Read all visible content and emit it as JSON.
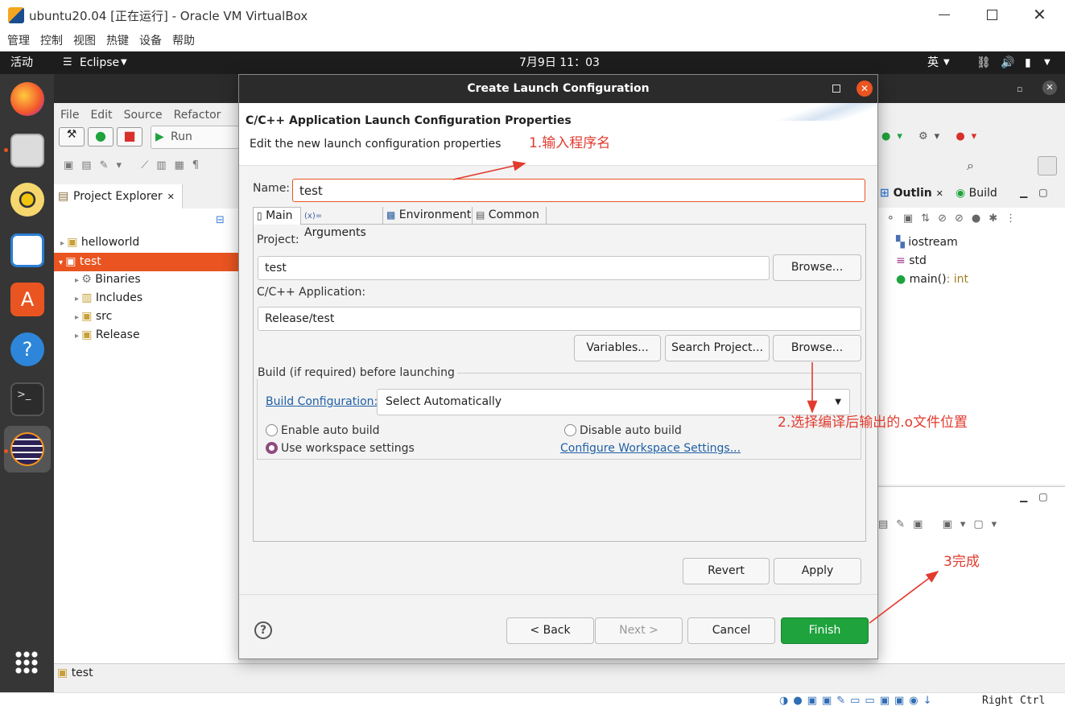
{
  "host": {
    "title": "ubuntu20.04 [正在运行] - Oracle VM VirtualBox",
    "menu": [
      "管理",
      "控制",
      "视图",
      "热键",
      "设备",
      "帮助"
    ],
    "host_key": "Right Ctrl"
  },
  "ubuntu": {
    "activities": "活动",
    "app_menu": "Eclipse",
    "clock": "7月9日  11：03",
    "input_method": "英"
  },
  "eclipse": {
    "menu": [
      "File",
      "Edit",
      "Source",
      "Refactor"
    ],
    "run_label": "Run",
    "project_explorer": "Project Explorer",
    "tree": [
      "helloworld",
      "test",
      "Binaries",
      "Includes",
      "src",
      "Release"
    ],
    "outline_tab": "Outlin",
    "build_tab": "Build",
    "outline_items": {
      "iostream": "iostream",
      "std": "std",
      "main": "main()",
      "main_type": ": int"
    },
    "status_selection": "test"
  },
  "dialog": {
    "title": "Create Launch Configuration",
    "header_title": "C/C++ Application Launch Configuration Properties",
    "header_desc": "Edit the new launch configuration properties",
    "name_label": "Name:",
    "name_value": "test",
    "tabs": [
      "Main",
      "Arguments",
      "Environment",
      "Common"
    ],
    "project_label": "Project:",
    "project_value": "test",
    "browse": "Browse...",
    "app_label": "C/C++ Application:",
    "app_value": "Release/test",
    "variables": "Variables...",
    "search_project": "Search Project...",
    "build_group": "Build (if required) before launching",
    "build_config_link": "Build Configuration:",
    "build_config_value": "Select Automatically",
    "enable_auto": "Enable auto build",
    "disable_auto": "Disable auto build",
    "use_workspace": "Use workspace settings",
    "configure_link": "Configure Workspace Settings...",
    "revert": "Revert",
    "apply": "Apply",
    "back": "< Back",
    "next": "Next >",
    "cancel": "Cancel",
    "finish": "Finish",
    "help_glyph": "?"
  },
  "annotations": {
    "a1": "1.输入程序名",
    "a2": "2.选择编译后输出的.o文件位置",
    "a3": "3完成"
  },
  "colors": {
    "accent": "#e95420",
    "finish": "#1fa33d",
    "annotation": "#e23a2e",
    "link": "#1f5fa5"
  }
}
